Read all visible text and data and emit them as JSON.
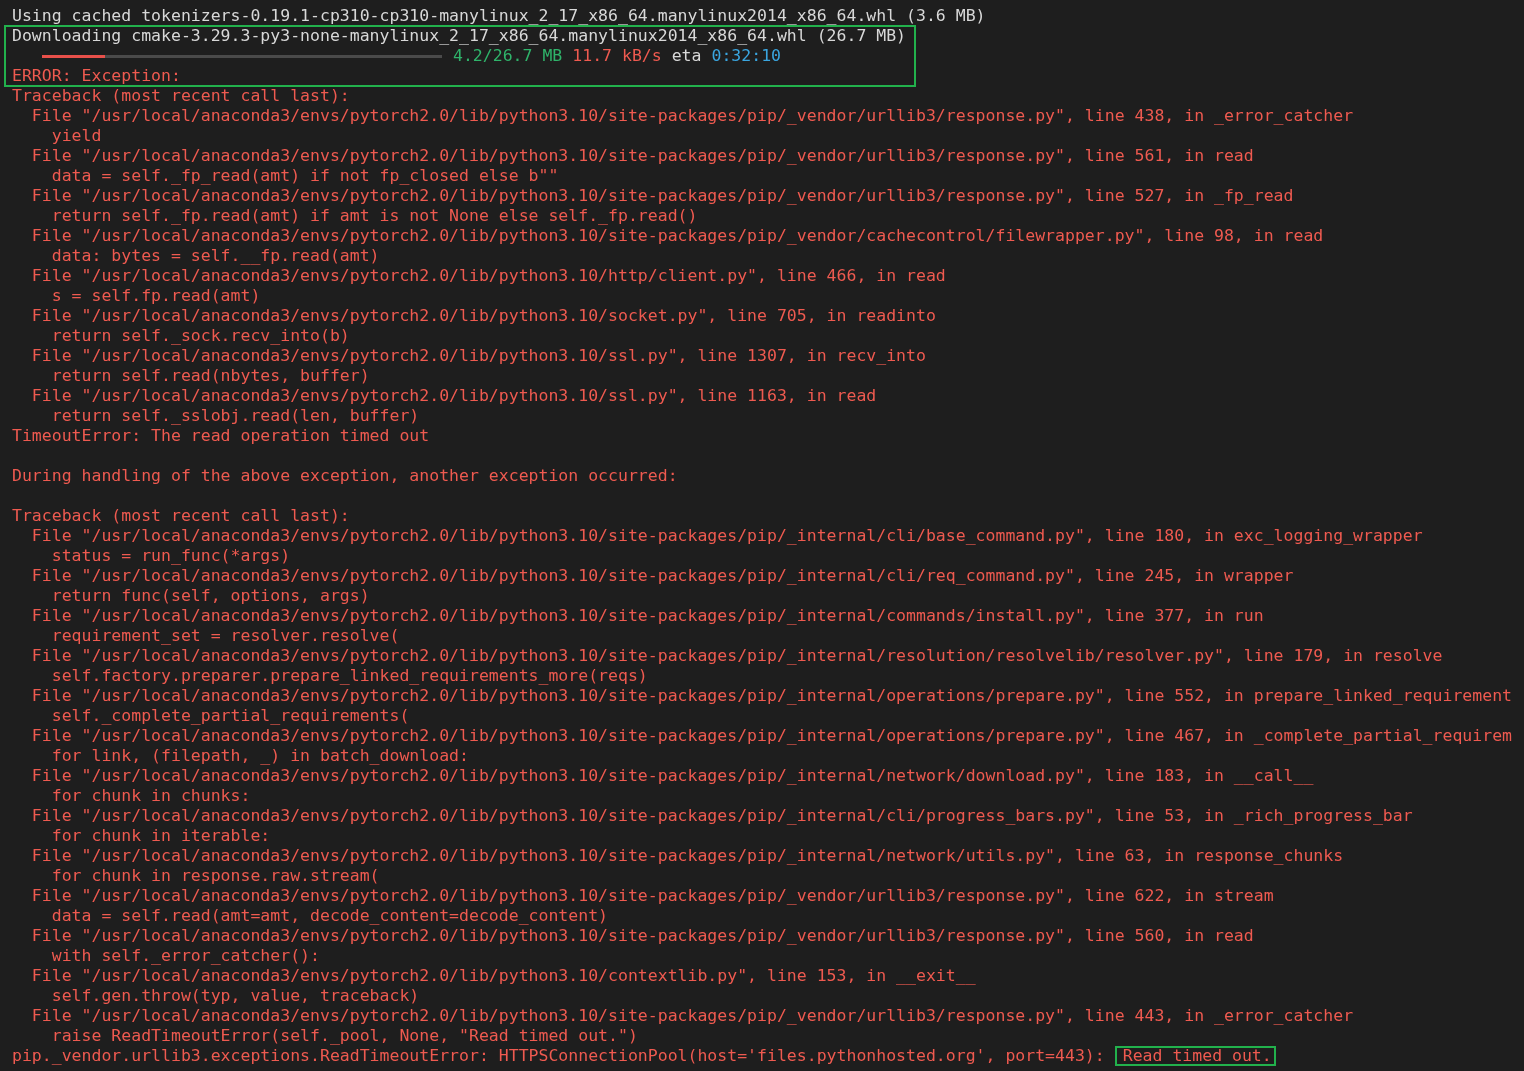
{
  "terminal": {
    "lines": [
      {
        "kind": "info",
        "text": "Using cached tokenizers-0.19.1-cp310-cp310-manylinux_2_17_x86_64.manylinux2014_x86_64.whl (3.6 MB)"
      },
      {
        "kind": "info",
        "text": "Downloading cmake-3.29.3-py3-none-manylinux_2_17_x86_64.manylinux2014_x86_64.whl (26.7 MB)"
      },
      {
        "kind": "progress",
        "level": 0.157,
        "size": "4.2/26.7 MB",
        "speed": "11.7 kB/s",
        "eta_label": "eta",
        "eta": "0:32:10"
      },
      {
        "kind": "error",
        "text": "ERROR: Exception:"
      },
      {
        "kind": "error",
        "text": "Traceback (most recent call last):"
      },
      {
        "kind": "error",
        "text": "  File \"/usr/local/anaconda3/envs/pytorch2.0/lib/python3.10/site-packages/pip/_vendor/urllib3/response.py\", line 438, in _error_catcher"
      },
      {
        "kind": "error",
        "text": "    yield"
      },
      {
        "kind": "error",
        "text": "  File \"/usr/local/anaconda3/envs/pytorch2.0/lib/python3.10/site-packages/pip/_vendor/urllib3/response.py\", line 561, in read"
      },
      {
        "kind": "error",
        "text": "    data = self._fp_read(amt) if not fp_closed else b\"\""
      },
      {
        "kind": "error",
        "text": "  File \"/usr/local/anaconda3/envs/pytorch2.0/lib/python3.10/site-packages/pip/_vendor/urllib3/response.py\", line 527, in _fp_read"
      },
      {
        "kind": "error",
        "text": "    return self._fp.read(amt) if amt is not None else self._fp.read()"
      },
      {
        "kind": "error",
        "text": "  File \"/usr/local/anaconda3/envs/pytorch2.0/lib/python3.10/site-packages/pip/_vendor/cachecontrol/filewrapper.py\", line 98, in read"
      },
      {
        "kind": "error",
        "text": "    data: bytes = self.__fp.read(amt)"
      },
      {
        "kind": "error",
        "text": "  File \"/usr/local/anaconda3/envs/pytorch2.0/lib/python3.10/http/client.py\", line 466, in read"
      },
      {
        "kind": "error",
        "text": "    s = self.fp.read(amt)"
      },
      {
        "kind": "error",
        "text": "  File \"/usr/local/anaconda3/envs/pytorch2.0/lib/python3.10/socket.py\", line 705, in readinto"
      },
      {
        "kind": "error",
        "text": "    return self._sock.recv_into(b)"
      },
      {
        "kind": "error",
        "text": "  File \"/usr/local/anaconda3/envs/pytorch2.0/lib/python3.10/ssl.py\", line 1307, in recv_into"
      },
      {
        "kind": "error",
        "text": "    return self.read(nbytes, buffer)"
      },
      {
        "kind": "error",
        "text": "  File \"/usr/local/anaconda3/envs/pytorch2.0/lib/python3.10/ssl.py\", line 1163, in read"
      },
      {
        "kind": "error",
        "text": "    return self._sslobj.read(len, buffer)"
      },
      {
        "kind": "error",
        "text": "TimeoutError: The read operation timed out"
      },
      {
        "kind": "blank"
      },
      {
        "kind": "error",
        "text": "During handling of the above exception, another exception occurred:"
      },
      {
        "kind": "blank"
      },
      {
        "kind": "error",
        "text": "Traceback (most recent call last):"
      },
      {
        "kind": "error",
        "text": "  File \"/usr/local/anaconda3/envs/pytorch2.0/lib/python3.10/site-packages/pip/_internal/cli/base_command.py\", line 180, in exc_logging_wrapper"
      },
      {
        "kind": "error",
        "text": "    status = run_func(*args)"
      },
      {
        "kind": "error",
        "text": "  File \"/usr/local/anaconda3/envs/pytorch2.0/lib/python3.10/site-packages/pip/_internal/cli/req_command.py\", line 245, in wrapper"
      },
      {
        "kind": "error",
        "text": "    return func(self, options, args)"
      },
      {
        "kind": "error",
        "text": "  File \"/usr/local/anaconda3/envs/pytorch2.0/lib/python3.10/site-packages/pip/_internal/commands/install.py\", line 377, in run"
      },
      {
        "kind": "error",
        "text": "    requirement_set = resolver.resolve("
      },
      {
        "kind": "error",
        "text": "  File \"/usr/local/anaconda3/envs/pytorch2.0/lib/python3.10/site-packages/pip/_internal/resolution/resolvelib/resolver.py\", line 179, in resolve"
      },
      {
        "kind": "error",
        "text": "    self.factory.preparer.prepare_linked_requirements_more(reqs)"
      },
      {
        "kind": "error",
        "text": "  File \"/usr/local/anaconda3/envs/pytorch2.0/lib/python3.10/site-packages/pip/_internal/operations/prepare.py\", line 552, in prepare_linked_requirement"
      },
      {
        "kind": "error",
        "text": "    self._complete_partial_requirements("
      },
      {
        "kind": "error",
        "text": "  File \"/usr/local/anaconda3/envs/pytorch2.0/lib/python3.10/site-packages/pip/_internal/operations/prepare.py\", line 467, in _complete_partial_requirem"
      },
      {
        "kind": "error",
        "text": "    for link, (filepath, _) in batch_download:"
      },
      {
        "kind": "error",
        "text": "  File \"/usr/local/anaconda3/envs/pytorch2.0/lib/python3.10/site-packages/pip/_internal/network/download.py\", line 183, in __call__"
      },
      {
        "kind": "error",
        "text": "    for chunk in chunks:"
      },
      {
        "kind": "error",
        "text": "  File \"/usr/local/anaconda3/envs/pytorch2.0/lib/python3.10/site-packages/pip/_internal/cli/progress_bars.py\", line 53, in _rich_progress_bar"
      },
      {
        "kind": "error",
        "text": "    for chunk in iterable:"
      },
      {
        "kind": "error",
        "text": "  File \"/usr/local/anaconda3/envs/pytorch2.0/lib/python3.10/site-packages/pip/_internal/network/utils.py\", line 63, in response_chunks"
      },
      {
        "kind": "error",
        "text": "    for chunk in response.raw.stream("
      },
      {
        "kind": "error",
        "text": "  File \"/usr/local/anaconda3/envs/pytorch2.0/lib/python3.10/site-packages/pip/_vendor/urllib3/response.py\", line 622, in stream"
      },
      {
        "kind": "error",
        "text": "    data = self.read(amt=amt, decode_content=decode_content)"
      },
      {
        "kind": "error",
        "text": "  File \"/usr/local/anaconda3/envs/pytorch2.0/lib/python3.10/site-packages/pip/_vendor/urllib3/response.py\", line 560, in read"
      },
      {
        "kind": "error",
        "text": "    with self._error_catcher():"
      },
      {
        "kind": "error",
        "text": "  File \"/usr/local/anaconda3/envs/pytorch2.0/lib/python3.10/contextlib.py\", line 153, in __exit__"
      },
      {
        "kind": "error",
        "text": "    self.gen.throw(typ, value, traceback)"
      },
      {
        "kind": "error",
        "text": "  File \"/usr/local/anaconda3/envs/pytorch2.0/lib/python3.10/site-packages/pip/_vendor/urllib3/response.py\", line 443, in _error_catcher"
      },
      {
        "kind": "error",
        "text": "    raise ReadTimeoutError(self._pool, None, \"Read timed out.\")"
      },
      {
        "kind": "error",
        "text": "pip._vendor.urllib3.exceptions.ReadTimeoutError: HTTPSConnectionPool(host='files.pythonhosted.org', port=443):",
        "highlight": "Read timed out."
      }
    ]
  }
}
